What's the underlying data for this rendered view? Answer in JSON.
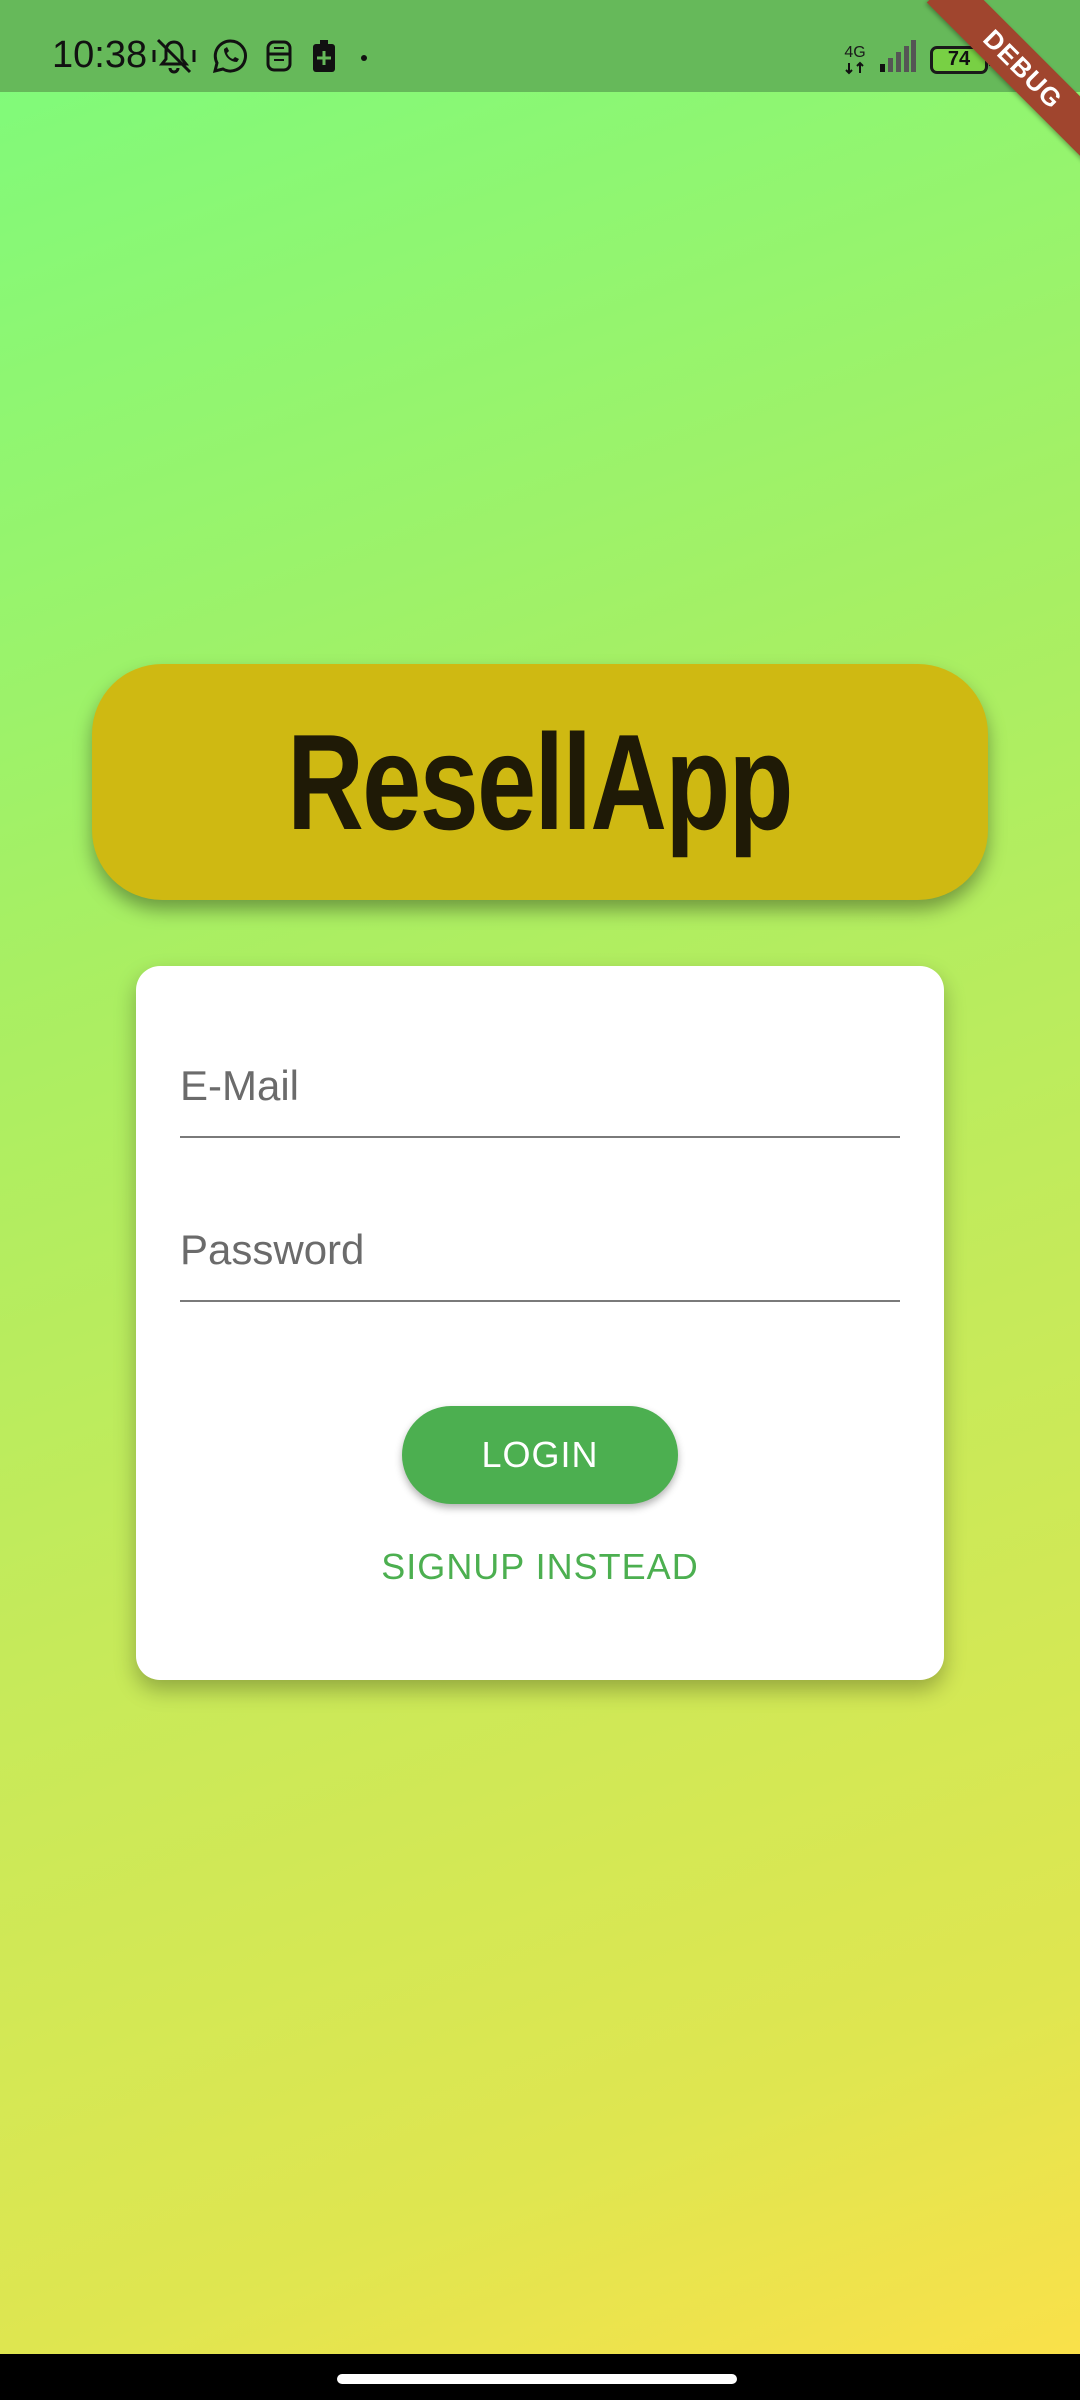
{
  "status_bar": {
    "time": "10:38",
    "network": "4G",
    "battery": "74",
    "icons_left": [
      "vibrate-mute-icon",
      "whatsapp-icon",
      "sim-icon",
      "battery-saver-icon",
      "dot-icon"
    ],
    "icons_right": [
      "network-4g-icon",
      "signal-icon",
      "battery-icon"
    ]
  },
  "debug_banner": "DEBUG",
  "logo": {
    "title": "ResellApp",
    "background_color": "#cfb912"
  },
  "login_form": {
    "email_placeholder": "E-Mail",
    "password_placeholder": "Password",
    "login_label": "LOGIN",
    "signup_label": "SIGNUP INSTEAD",
    "accent_color": "#4caf50"
  }
}
